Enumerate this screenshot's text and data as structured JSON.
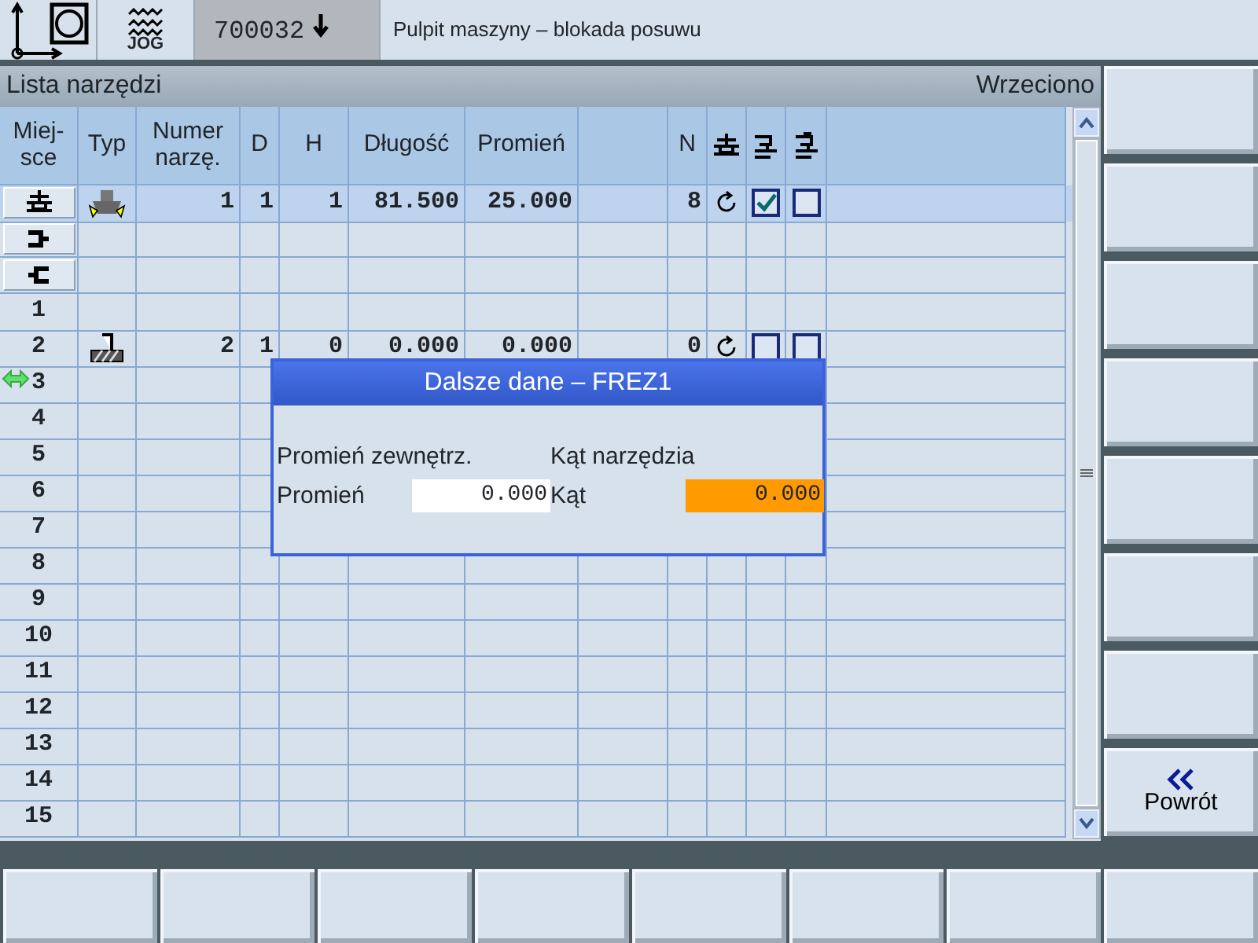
{
  "header": {
    "mode": "JOG",
    "alarm_number": "700032",
    "message": "Pulpit maszyny – blokada posuwu"
  },
  "panel": {
    "title": "Lista narzędzi",
    "spindle_label": "Wrzeciono"
  },
  "table": {
    "columns": [
      {
        "kind": "text",
        "label": "Miej-\nsce"
      },
      {
        "kind": "text",
        "label": "Typ"
      },
      {
        "kind": "text",
        "label": "Numer\nnarzę."
      },
      {
        "kind": "text",
        "label": "D"
      },
      {
        "kind": "text",
        "label": "H"
      },
      {
        "kind": "text",
        "label": "Długość"
      },
      {
        "kind": "text",
        "label": "Promień"
      },
      {
        "kind": "blank"
      },
      {
        "kind": "text",
        "label": "N"
      },
      {
        "kind": "spindle-icon"
      },
      {
        "kind": "coolant-1-icon"
      },
      {
        "kind": "coolant-2-icon"
      }
    ],
    "rows": [
      {
        "kind": "spindle",
        "selected": true,
        "moving": false,
        "tool": {
          "kind": "face-mill",
          "number": "1",
          "d": "1",
          "h": "1",
          "length": "81.500",
          "radius": "25.000",
          "n": "8",
          "rotation": true,
          "coolant_1": true,
          "coolant_2": false
        }
      },
      {
        "kind": "gripper-right",
        "selected": false,
        "moving": false
      },
      {
        "kind": "gripper-left",
        "selected": false,
        "moving": false
      },
      {
        "kind": "slot",
        "place": "1",
        "selected": false,
        "moving": false
      },
      {
        "kind": "slot",
        "place": "2",
        "selected": false,
        "moving": false,
        "tool": {
          "kind": "end-mill",
          "number": "2",
          "d": "1",
          "h": "0",
          "length": "0.000",
          "radius": "0.000",
          "n": "0",
          "rotation": true,
          "coolant_1": false,
          "coolant_2": false
        }
      },
      {
        "kind": "slot",
        "place": "3",
        "selected": false,
        "moving": true
      },
      {
        "kind": "slot",
        "place": "4",
        "selected": false,
        "moving": false
      },
      {
        "kind": "slot",
        "place": "5",
        "selected": false,
        "moving": false
      },
      {
        "kind": "slot",
        "place": "6",
        "selected": false,
        "moving": false
      },
      {
        "kind": "slot",
        "place": "7",
        "selected": false,
        "moving": false
      },
      {
        "kind": "slot",
        "place": "8",
        "selected": false,
        "moving": false
      },
      {
        "kind": "slot",
        "place": "9",
        "selected": false,
        "moving": false
      },
      {
        "kind": "slot",
        "place": "10",
        "selected": false,
        "moving": false
      },
      {
        "kind": "slot",
        "place": "11",
        "selected": false,
        "moving": false
      },
      {
        "kind": "slot",
        "place": "12",
        "selected": false,
        "moving": false
      },
      {
        "kind": "slot",
        "place": "13",
        "selected": false,
        "moving": false
      },
      {
        "kind": "slot",
        "place": "14",
        "selected": false,
        "moving": false
      },
      {
        "kind": "slot",
        "place": "15",
        "selected": false,
        "moving": false
      }
    ]
  },
  "dialog": {
    "title": "Dalsze dane – FREZ1",
    "groups": [
      {
        "heading": "Promień zewnętrz.",
        "label": "Promień",
        "value": "0.000",
        "focused": false
      },
      {
        "heading": "Kąt narzędzia",
        "label": "Kąt",
        "value": "0.000",
        "focused": true
      }
    ]
  },
  "vertical_softkeys": [
    {
      "kind": "blank"
    },
    {
      "kind": "blank"
    },
    {
      "kind": "blank"
    },
    {
      "kind": "blank"
    },
    {
      "kind": "blank"
    },
    {
      "kind": "blank"
    },
    {
      "kind": "blank"
    },
    {
      "kind": "back",
      "label": "Powrót"
    }
  ],
  "horizontal_softkeys": [
    {
      "kind": "blank"
    },
    {
      "kind": "blank"
    },
    {
      "kind": "blank"
    },
    {
      "kind": "blank"
    },
    {
      "kind": "blank"
    },
    {
      "kind": "blank"
    },
    {
      "kind": "blank"
    },
    {
      "kind": "blank"
    }
  ]
}
